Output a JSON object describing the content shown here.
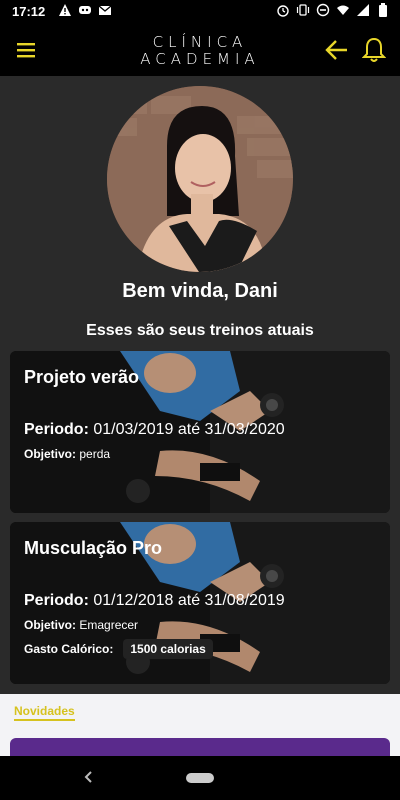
{
  "statusbar": {
    "time": "17:12",
    "icons_left": [
      "warning-icon",
      "discord-icon",
      "gmail-icon"
    ],
    "icons_right": [
      "alarm-icon",
      "vibrate-icon",
      "dnd-icon",
      "wifi-icon",
      "signal-icon",
      "battery-icon"
    ]
  },
  "appbar": {
    "logo_line1": "CLÍNICA",
    "logo_line2": "ACADEMIA",
    "accent_color": "#e8d62a"
  },
  "profile": {
    "greeting": "Bem vinda, Dani",
    "subtitle": "Esses são seus treinos atuais"
  },
  "workouts": [
    {
      "title": "Projeto verão",
      "periodo_label": "Periodo:",
      "periodo_value": "01/03/2019 até 31/03/2020",
      "objetivo_label": "Objetivo:",
      "objetivo_value": "perda"
    },
    {
      "title": "Musculação Pro",
      "periodo_label": "Periodo:",
      "periodo_value": "01/12/2018 até 31/08/2019",
      "objetivo_label": "Objetivo:",
      "objetivo_value": "Emagrecer",
      "gasto_label": "Gasto Calórico:",
      "gasto_value": "1500 calorias"
    }
  ],
  "news": {
    "label": "Novidades",
    "card_color": "#5a2a8c"
  }
}
